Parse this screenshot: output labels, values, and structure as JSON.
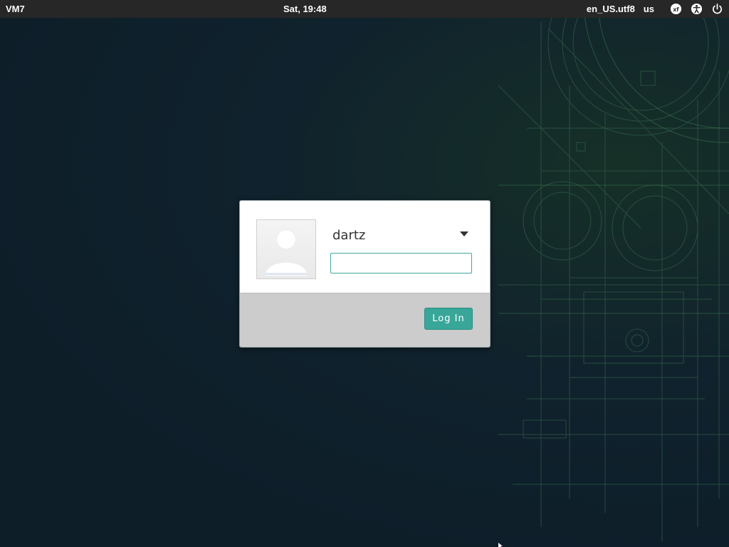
{
  "top_panel": {
    "host": "VM7",
    "clock": "Sat, 19:48",
    "locale": "en_US.utf8",
    "keyboard_layout": "us",
    "icons": [
      "xfce-icon",
      "accessibility-icon",
      "power-icon"
    ]
  },
  "login": {
    "username": "dartz",
    "password_value": "",
    "login_label": "Log In"
  },
  "colors": {
    "accent": "#38a79a",
    "panel_bg": "#272727",
    "desktop_bg": "#0f1f2b"
  }
}
